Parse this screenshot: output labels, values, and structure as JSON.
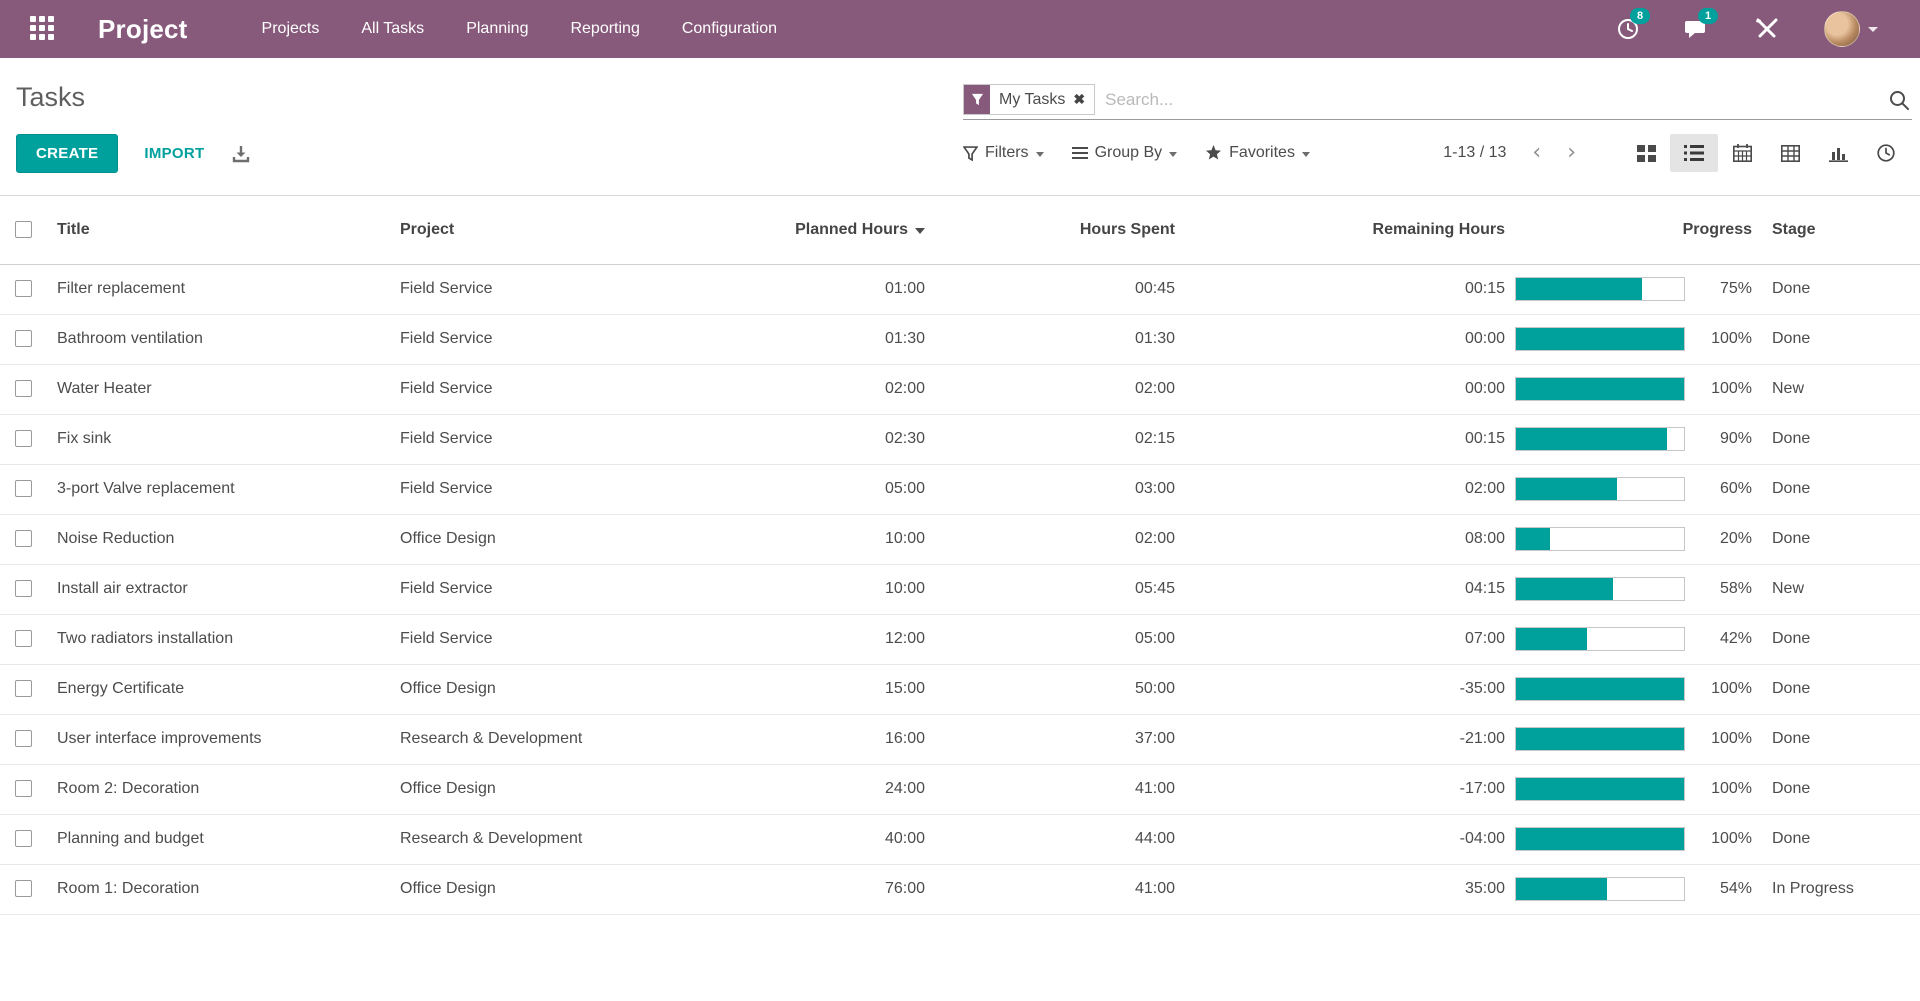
{
  "nav": {
    "brand": "Project",
    "items": [
      {
        "label": "Projects"
      },
      {
        "label": "All Tasks"
      },
      {
        "label": "Planning"
      },
      {
        "label": "Reporting"
      },
      {
        "label": "Configuration"
      }
    ],
    "activity_badge": "8",
    "messages_badge": "1"
  },
  "page": {
    "title": "Tasks"
  },
  "actions": {
    "create_label": "CREATE",
    "import_label": "IMPORT"
  },
  "search": {
    "facet_label": "My Tasks",
    "placeholder": "Search..."
  },
  "controls": {
    "filters_label": "Filters",
    "group_by_label": "Group By",
    "favorites_label": "Favorites",
    "pager_text": "1-13 / 13"
  },
  "icons": {
    "nav": [
      "apps-grid-icon",
      "activity-clock-icon",
      "messages-bubble-icon",
      "developer-tools-icon",
      "user-avatar",
      "chevron-down-icon"
    ],
    "search": [
      "filter-funnel-icon",
      "remove-facet-icon",
      "search-magnifier-icon"
    ],
    "toolbar": [
      "filter-funnel-icon",
      "group-by-bars-icon",
      "favorites-star-icon",
      "download-icon"
    ],
    "view_switcher": [
      "kanban-view-icon",
      "list-view-icon",
      "calendar-view-icon",
      "pivot-view-icon",
      "graph-view-icon",
      "activity-view-icon"
    ]
  },
  "colors": {
    "nav_bg": "#875A7B",
    "accent": "#00A09D",
    "progress_fill": "#00A09D",
    "active_view_bg": "#e4e4e4"
  },
  "table": {
    "headers": {
      "title": "Title",
      "project": "Project",
      "planned": "Planned Hours",
      "spent": "Hours Spent",
      "remaining": "Remaining Hours",
      "progress": "Progress",
      "stage": "Stage"
    },
    "sorted_by": "Planned Hours",
    "rows": [
      {
        "title": "Filter replacement",
        "project": "Field Service",
        "planned": "01:00",
        "spent": "00:45",
        "remaining": "00:15",
        "progress": 75,
        "progress_label": "75%",
        "stage": "Done"
      },
      {
        "title": "Bathroom ventilation",
        "project": "Field Service",
        "planned": "01:30",
        "spent": "01:30",
        "remaining": "00:00",
        "progress": 100,
        "progress_label": "100%",
        "stage": "Done"
      },
      {
        "title": "Water Heater",
        "project": "Field Service",
        "planned": "02:00",
        "spent": "02:00",
        "remaining": "00:00",
        "progress": 100,
        "progress_label": "100%",
        "stage": "New"
      },
      {
        "title": "Fix sink",
        "project": "Field Service",
        "planned": "02:30",
        "spent": "02:15",
        "remaining": "00:15",
        "progress": 90,
        "progress_label": "90%",
        "stage": "Done"
      },
      {
        "title": "3-port Valve replacement",
        "project": "Field Service",
        "planned": "05:00",
        "spent": "03:00",
        "remaining": "02:00",
        "progress": 60,
        "progress_label": "60%",
        "stage": "Done"
      },
      {
        "title": "Noise Reduction",
        "project": "Office Design",
        "planned": "10:00",
        "spent": "02:00",
        "remaining": "08:00",
        "progress": 20,
        "progress_label": "20%",
        "stage": "Done"
      },
      {
        "title": "Install air extractor",
        "project": "Field Service",
        "planned": "10:00",
        "spent": "05:45",
        "remaining": "04:15",
        "progress": 58,
        "progress_label": "58%",
        "stage": "New"
      },
      {
        "title": "Two radiators installation",
        "project": "Field Service",
        "planned": "12:00",
        "spent": "05:00",
        "remaining": "07:00",
        "progress": 42,
        "progress_label": "42%",
        "stage": "Done"
      },
      {
        "title": "Energy Certificate",
        "project": "Office Design",
        "planned": "15:00",
        "spent": "50:00",
        "remaining": "-35:00",
        "progress": 100,
        "progress_label": "100%",
        "stage": "Done"
      },
      {
        "title": "User interface improvements",
        "project": "Research & Development",
        "planned": "16:00",
        "spent": "37:00",
        "remaining": "-21:00",
        "progress": 100,
        "progress_label": "100%",
        "stage": "Done"
      },
      {
        "title": "Room 2: Decoration",
        "project": "Office Design",
        "planned": "24:00",
        "spent": "41:00",
        "remaining": "-17:00",
        "progress": 100,
        "progress_label": "100%",
        "stage": "Done"
      },
      {
        "title": "Planning and budget",
        "project": "Research & Development",
        "planned": "40:00",
        "spent": "44:00",
        "remaining": "-04:00",
        "progress": 100,
        "progress_label": "100%",
        "stage": "Done"
      },
      {
        "title": "Room 1: Decoration",
        "project": "Office Design",
        "planned": "76:00",
        "spent": "41:00",
        "remaining": "35:00",
        "progress": 54,
        "progress_label": "54%",
        "stage": "In Progress"
      }
    ]
  }
}
